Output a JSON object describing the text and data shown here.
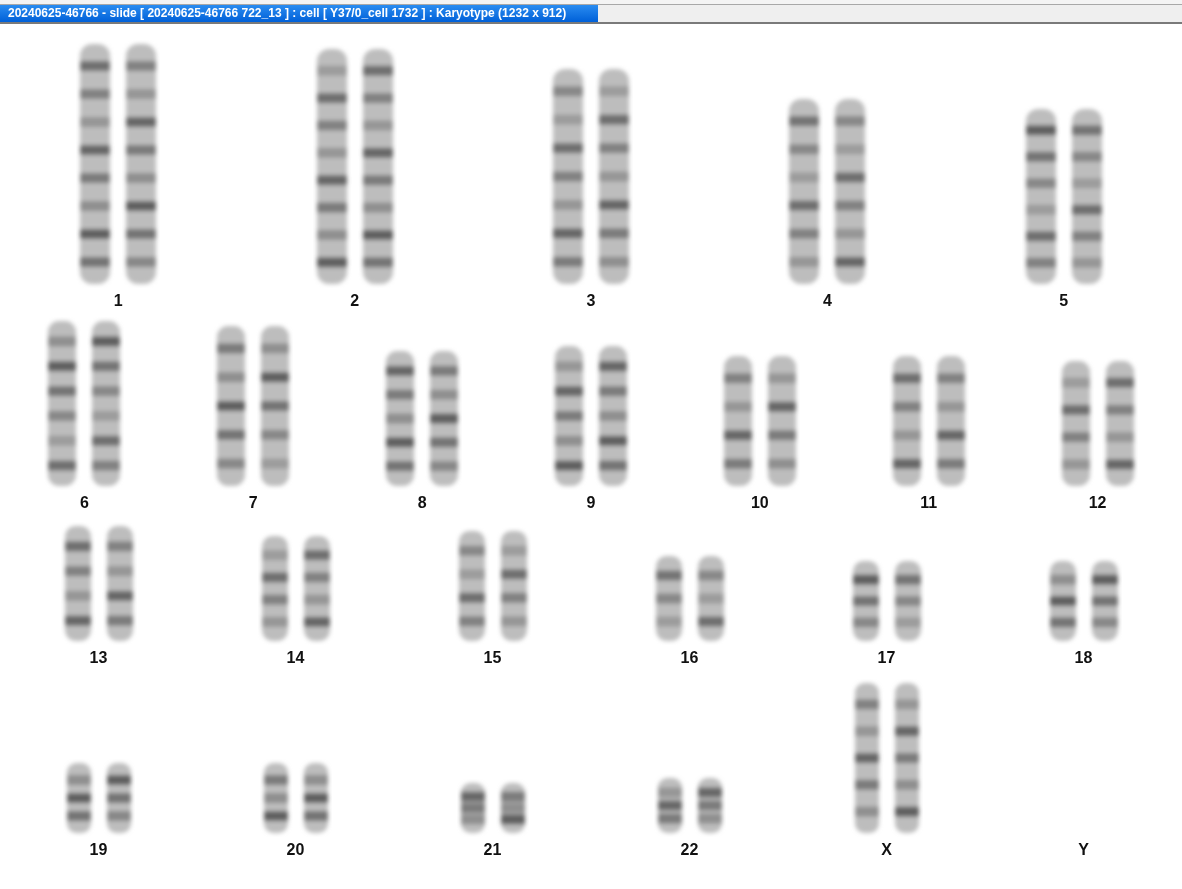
{
  "window": {
    "title": "20240625-46766 - slide [ 20240625-46766 722_13 ] : cell [ Y37/0_cell 1732 ] : Karyotype  (1232 x 912)"
  },
  "karyotype": {
    "rows": [
      {
        "pairs": [
          {
            "label": "1",
            "kind": "pair"
          },
          {
            "label": "2",
            "kind": "pair"
          },
          {
            "label": "3",
            "kind": "pair"
          },
          {
            "label": "4",
            "kind": "pair"
          },
          {
            "label": "5",
            "kind": "pair"
          }
        ]
      },
      {
        "pairs": [
          {
            "label": "6",
            "kind": "pair"
          },
          {
            "label": "7",
            "kind": "pair"
          },
          {
            "label": "8",
            "kind": "pair"
          },
          {
            "label": "9",
            "kind": "pair"
          },
          {
            "label": "10",
            "kind": "pair"
          },
          {
            "label": "11",
            "kind": "pair"
          },
          {
            "label": "12",
            "kind": "pair"
          }
        ]
      },
      {
        "pairs": [
          {
            "label": "13",
            "kind": "pair"
          },
          {
            "label": "14",
            "kind": "pair"
          },
          {
            "label": "15",
            "kind": "pair"
          },
          {
            "label": "16",
            "kind": "pair"
          },
          {
            "label": "17",
            "kind": "pair"
          },
          {
            "label": "18",
            "kind": "pair"
          }
        ]
      },
      {
        "pairs": [
          {
            "label": "19",
            "kind": "pair"
          },
          {
            "label": "20",
            "kind": "pair"
          },
          {
            "label": "21",
            "kind": "pair"
          },
          {
            "label": "22",
            "kind": "pair"
          },
          {
            "label": "X",
            "kind": "pair"
          },
          {
            "label": "Y",
            "kind": "empty"
          }
        ]
      }
    ]
  }
}
